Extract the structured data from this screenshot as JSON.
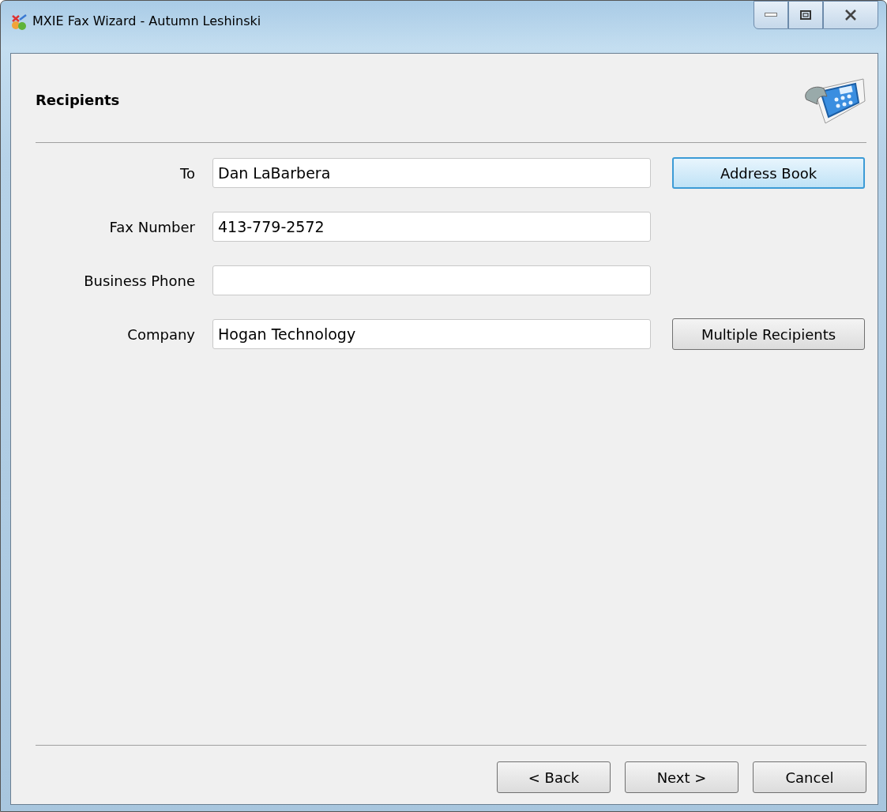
{
  "window": {
    "title": "MXIE Fax Wizard - Autumn Leshinski"
  },
  "page": {
    "title": "Recipients"
  },
  "fields": [
    {
      "label": "To",
      "value": "Dan LaBarbera",
      "button": {
        "label": "Address Book",
        "focused": true
      }
    },
    {
      "label": "Fax Number",
      "value": "413-779-2572"
    },
    {
      "label": "Business Phone"
    },
    {
      "label": "Company",
      "value": "Hogan Technology",
      "button": {
        "label": "Multiple Recipients",
        "focused": false
      }
    }
  ],
  "nav_buttons": [
    "< Back",
    "Next >",
    "Cancel"
  ]
}
